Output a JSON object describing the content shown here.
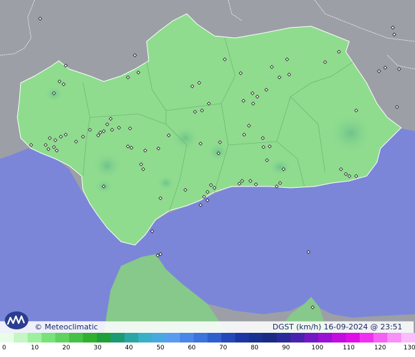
{
  "map": {
    "brand": "© Meteoclimatic",
    "product": "DGST (km/h)",
    "timestamp": "16-09-2024 @ 23:51 UTC",
    "colors": {
      "sea": "#7b86d9",
      "land_outside": "#9c9fa6",
      "region_fill": "#8fdc8f",
      "morocco_fill": "#86c98a",
      "station_marker": "#1a1a1a"
    }
  },
  "legend": {
    "ticks": [
      "0",
      "10",
      "20",
      "30",
      "40",
      "50",
      "60",
      "70",
      "80",
      "90",
      "100",
      "110",
      "120",
      "130"
    ],
    "colors": [
      "#e8fde8",
      "#c6f5c6",
      "#9df09d",
      "#78e278",
      "#5fd25f",
      "#46c046",
      "#2fb12f",
      "#1f9f3a",
      "#1e9a72",
      "#2aa6a6",
      "#3ab0c8",
      "#4aa8e0",
      "#5b9bef",
      "#4a86e8",
      "#3c73dc",
      "#2f5fcf",
      "#2547b9",
      "#1c37a3",
      "#18308f",
      "#1a2a82",
      "#2a2a9a",
      "#4a22b0",
      "#7218c4",
      "#9a10d4",
      "#c20ce0",
      "#e00ce8",
      "#f030f0",
      "#f560f5",
      "#f890f8",
      "#fbbcfb"
    ]
  }
}
